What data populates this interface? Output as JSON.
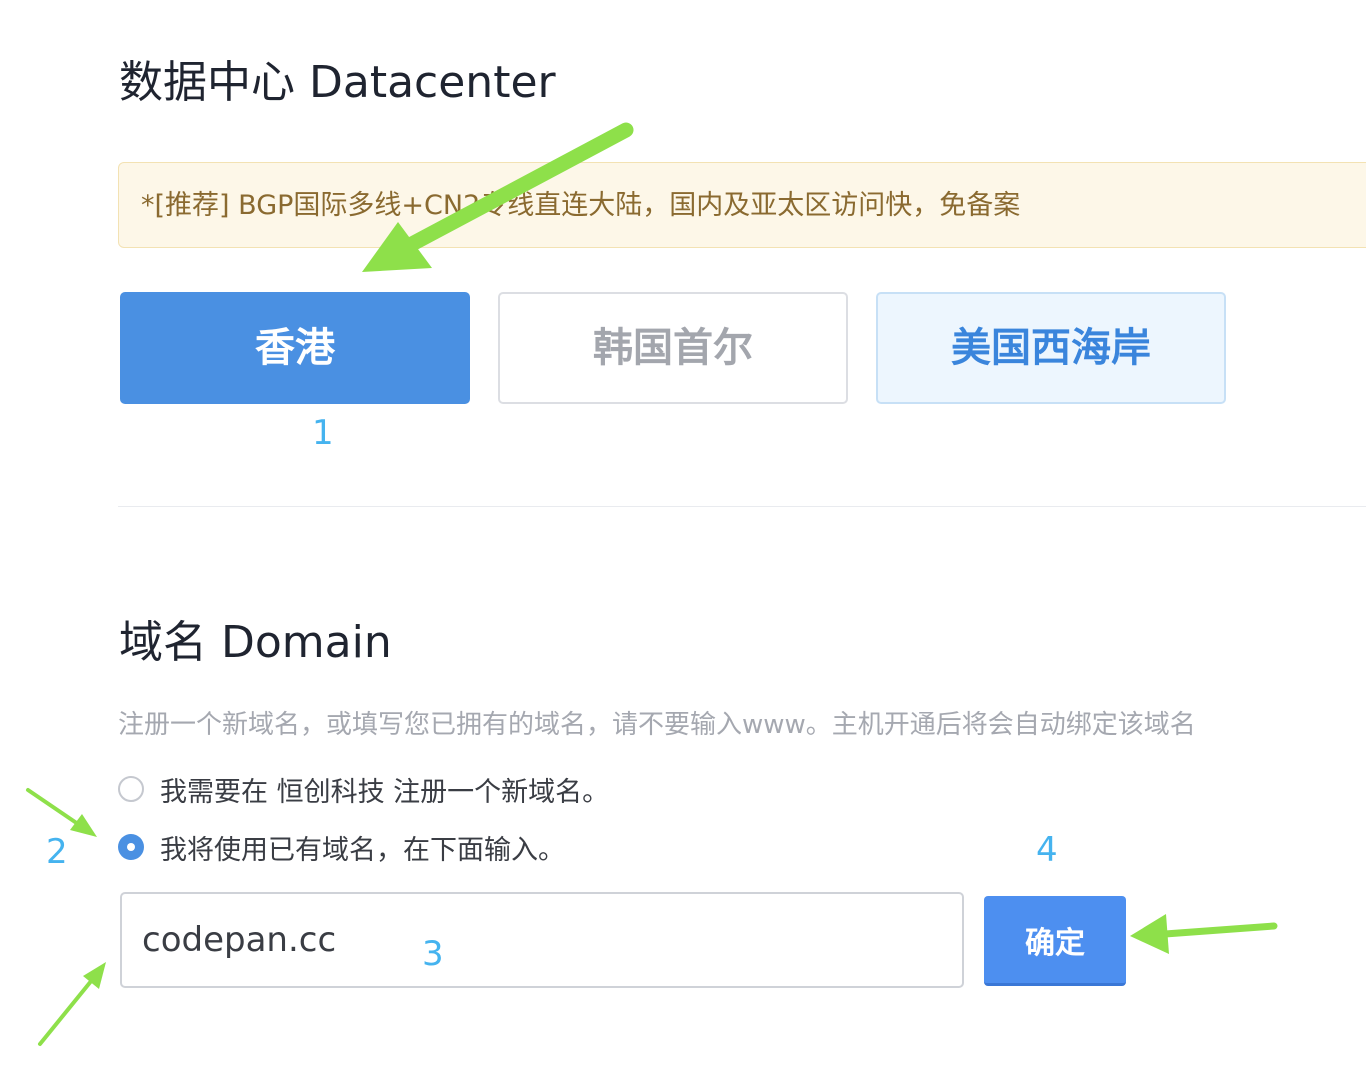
{
  "datacenter": {
    "title": "数据中心 Datacenter",
    "notice": "*[推荐] BGP国际多线+CN2专线直连大陆，国内及亚太区访问快，免备案",
    "options": [
      {
        "label": "香港",
        "state": "selected"
      },
      {
        "label": "韩国首尔",
        "state": "disabled"
      },
      {
        "label": "美国西海岸",
        "state": "available"
      }
    ]
  },
  "domain": {
    "title": "域名 Domain",
    "hint": "注册一个新域名，或填写您已拥有的域名，请不要输入www。主机开通后将会自动绑定该域名",
    "radios": [
      {
        "label": "我需要在 恒创科技 注册一个新域名。",
        "checked": false
      },
      {
        "label": "我将使用已有域名，在下面输入。",
        "checked": true
      }
    ],
    "input_value": "codepan.cc",
    "confirm_label": "确定"
  },
  "annotations": {
    "step1": "1",
    "step2": "2",
    "step3": "3",
    "step4": "4",
    "arrow_color": "#8ee04a"
  },
  "colors": {
    "primary": "#4a90e2",
    "notice_bg": "#fdf7e8",
    "notice_text": "#8a6a30",
    "step_number": "#45b3ef"
  }
}
